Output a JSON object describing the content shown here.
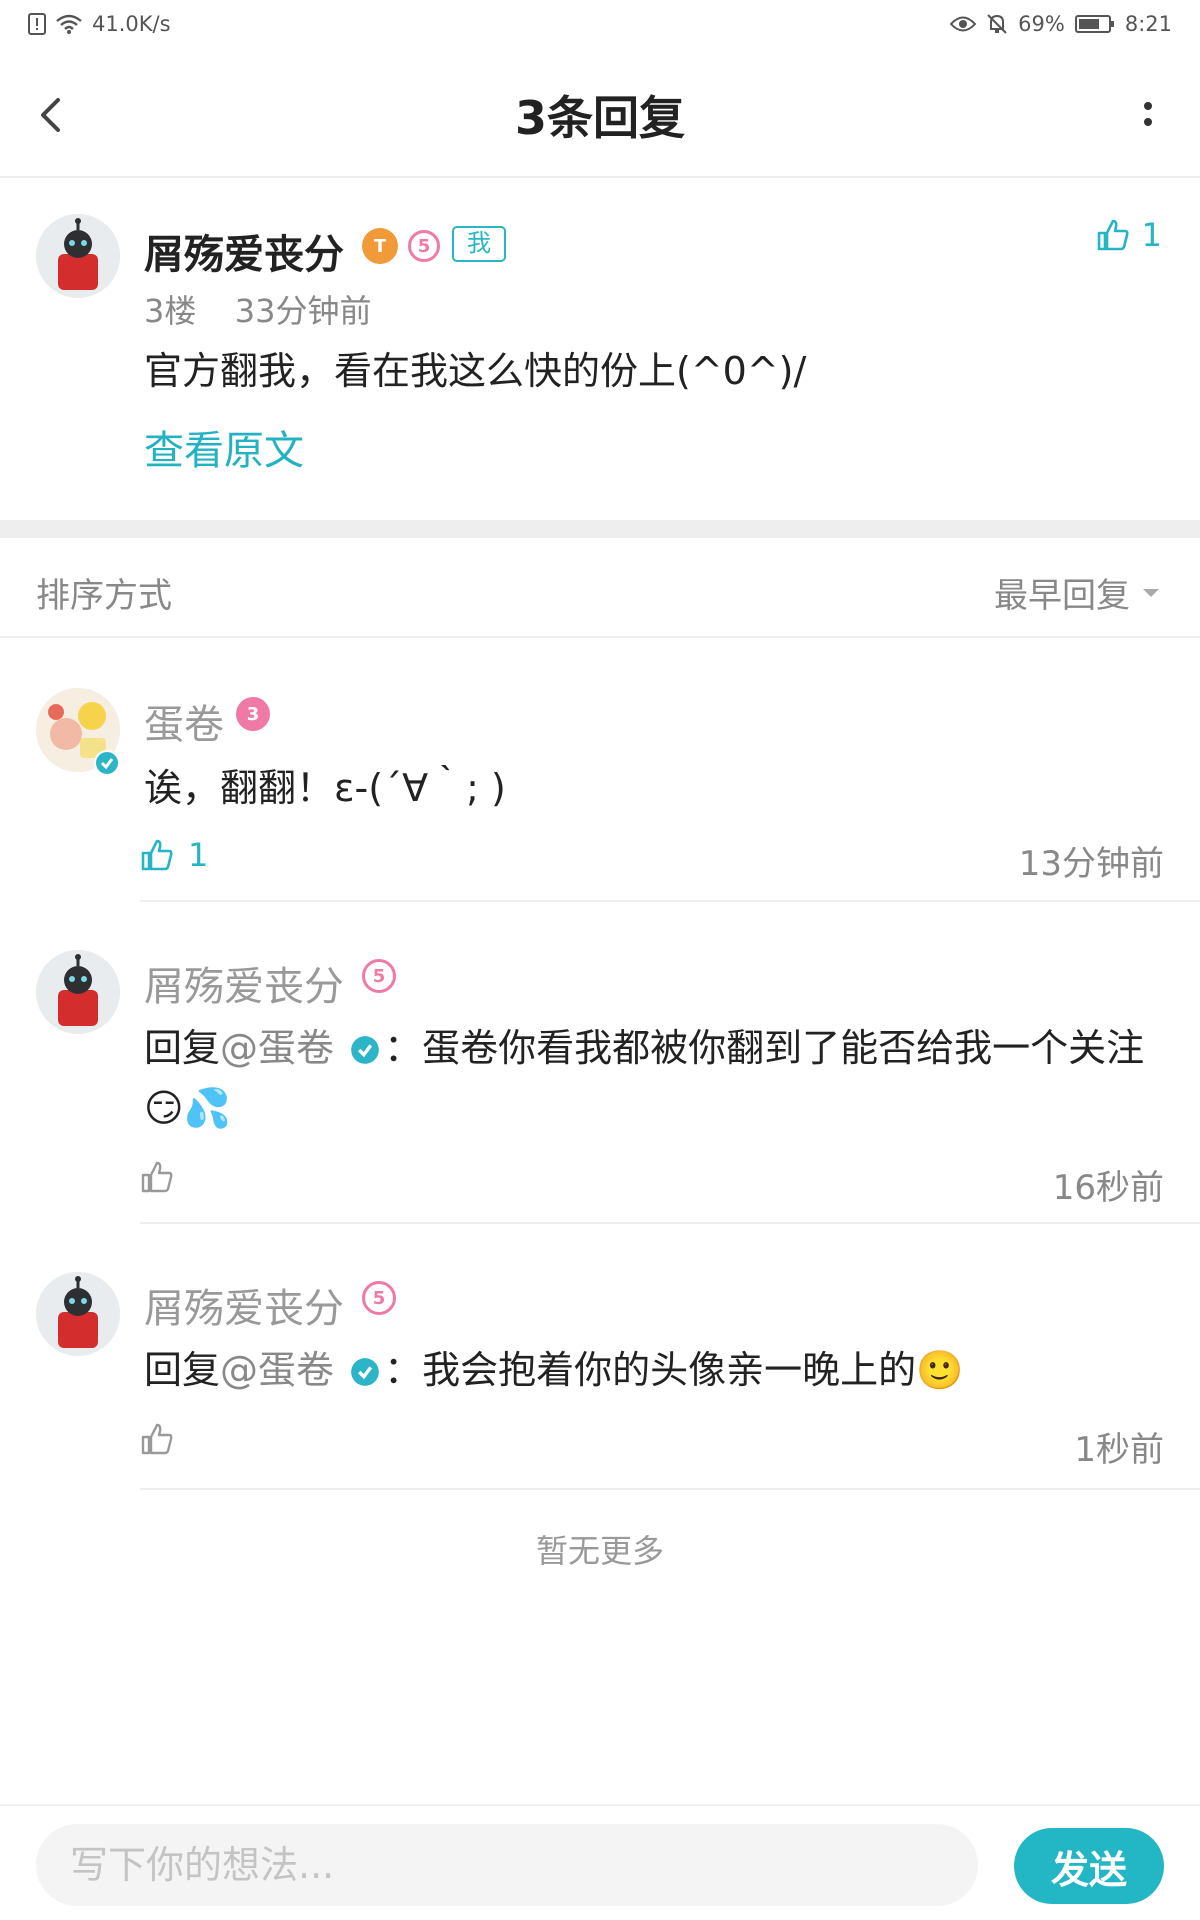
{
  "status_bar": {
    "net_speed": "41.0K/s",
    "battery": "69%",
    "time": "8:21"
  },
  "header": {
    "title": "3条回复"
  },
  "post": {
    "author": "屑殇爱丧分",
    "me_tag": "我",
    "floor": "3楼",
    "time": "33分钟前",
    "content": "官方翻我，看在我这么快的份上(^0^)/",
    "view_original": "查看原文",
    "likes": "1",
    "level_badge": "5"
  },
  "sort": {
    "label": "排序方式",
    "value": "最早回复"
  },
  "replies": [
    {
      "name": "蛋卷",
      "level_badge": "3",
      "text": "诶，翻翻！ε-(´∀｀; )",
      "likes": "1",
      "time": "13分钟前"
    },
    {
      "name": "屑殇爱丧分",
      "level_badge": "5",
      "prefix": "回复",
      "mention": "@蛋卷",
      "text": "：蛋卷你看我都被你翻到了能否给我一个关注",
      "emojis": "😏💦",
      "likes": "",
      "time": "16秒前"
    },
    {
      "name": "屑殇爱丧分",
      "level_badge": "5",
      "prefix": "回复",
      "mention": "@蛋卷",
      "text": "：我会抱着你的头像亲一晚上的",
      "emojis": "🙂",
      "likes": "",
      "time": "1秒前"
    }
  ],
  "footer": {
    "no_more": "暂无更多",
    "input_placeholder": "写下你的想法...",
    "send_label": "发送"
  },
  "colors": {
    "accent": "#23b6c4",
    "level_pink": "#f07aa5",
    "badge_orange": "#f29a3a"
  }
}
